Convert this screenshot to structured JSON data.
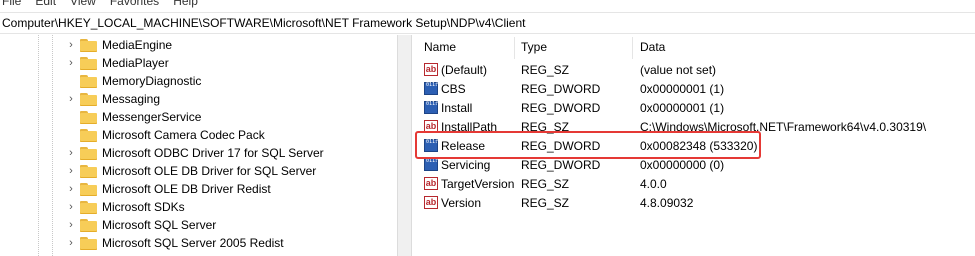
{
  "menu": [
    "File",
    "Edit",
    "View",
    "Favorites",
    "Help"
  ],
  "address": "Computer\\HKEY_LOCAL_MACHINE\\SOFTWARE\\Microsoft\\NET Framework Setup\\NDP\\v4\\Client",
  "tree": [
    {
      "label": "MediaEngine",
      "expandable": true
    },
    {
      "label": "MediaPlayer",
      "expandable": true
    },
    {
      "label": "MemoryDiagnostic",
      "expandable": false
    },
    {
      "label": "Messaging",
      "expandable": true
    },
    {
      "label": "MessengerService",
      "expandable": false
    },
    {
      "label": "Microsoft Camera Codec Pack",
      "expandable": false
    },
    {
      "label": "Microsoft ODBC Driver 17 for SQL Server",
      "expandable": true
    },
    {
      "label": "Microsoft OLE DB Driver for SQL Server",
      "expandable": true
    },
    {
      "label": "Microsoft OLE DB Driver Redist",
      "expandable": true
    },
    {
      "label": "Microsoft SDKs",
      "expandable": true
    },
    {
      "label": "Microsoft SQL Server",
      "expandable": true
    },
    {
      "label": "Microsoft SQL Server 2005 Redist",
      "expandable": true
    }
  ],
  "columns": {
    "name": "Name",
    "type": "Type",
    "data": "Data"
  },
  "values": [
    {
      "name": "(Default)",
      "type": "REG_SZ",
      "data": "(value not set)",
      "icon": "string-value-icon"
    },
    {
      "name": "CBS",
      "type": "REG_DWORD",
      "data": "0x00000001 (1)",
      "icon": "dword-value-icon"
    },
    {
      "name": "Install",
      "type": "REG_DWORD",
      "data": "0x00000001 (1)",
      "icon": "dword-value-icon"
    },
    {
      "name": "InstallPath",
      "type": "REG_SZ",
      "data": "C:\\Windows\\Microsoft.NET\\Framework64\\v4.0.30319\\",
      "icon": "string-value-icon"
    },
    {
      "name": "Release",
      "type": "REG_DWORD",
      "data": "0x00082348 (533320)",
      "icon": "dword-value-icon"
    },
    {
      "name": "Servicing",
      "type": "REG_DWORD",
      "data": "0x00000000 (0)",
      "icon": "dword-value-icon"
    },
    {
      "name": "TargetVersion",
      "type": "REG_SZ",
      "data": "4.0.0",
      "icon": "string-value-icon"
    },
    {
      "name": "Version",
      "type": "REG_SZ",
      "data": "4.8.09032",
      "icon": "string-value-icon"
    }
  ],
  "highlight_color": "#e53935",
  "folder_color": "#f7cd58"
}
